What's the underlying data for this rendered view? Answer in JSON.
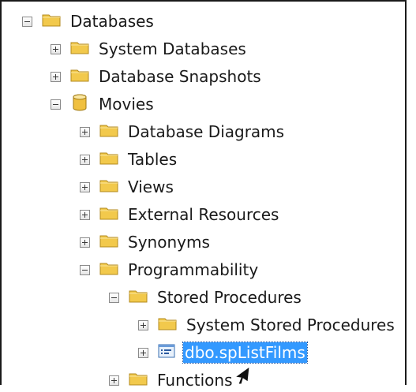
{
  "tree": {
    "items": [
      {
        "label": "Databases",
        "level": 0,
        "state": "expanded",
        "icon": "folder-icon"
      },
      {
        "label": "System Databases",
        "level": 1,
        "state": "collapsed",
        "icon": "folder-icon"
      },
      {
        "label": "Database Snapshots",
        "level": 1,
        "state": "collapsed",
        "icon": "folder-icon"
      },
      {
        "label": "Movies",
        "level": 1,
        "state": "expanded",
        "icon": "database-icon"
      },
      {
        "label": "Database Diagrams",
        "level": 2,
        "state": "collapsed",
        "icon": "folder-icon"
      },
      {
        "label": "Tables",
        "level": 2,
        "state": "collapsed",
        "icon": "folder-icon"
      },
      {
        "label": "Views",
        "level": 2,
        "state": "collapsed",
        "icon": "folder-icon"
      },
      {
        "label": "External Resources",
        "level": 2,
        "state": "collapsed",
        "icon": "folder-icon"
      },
      {
        "label": "Synonyms",
        "level": 2,
        "state": "collapsed",
        "icon": "folder-icon"
      },
      {
        "label": "Programmability",
        "level": 2,
        "state": "expanded",
        "icon": "folder-icon"
      },
      {
        "label": "Stored Procedures",
        "level": 3,
        "state": "expanded",
        "icon": "folder-icon"
      },
      {
        "label": "System Stored Procedures",
        "level": 4,
        "state": "collapsed",
        "icon": "folder-icon"
      },
      {
        "label": "dbo.spListFilms",
        "level": 4,
        "state": "collapsed",
        "icon": "stored-procedure-icon",
        "selected": true
      },
      {
        "label": "Functions",
        "level": 3,
        "state": "collapsed",
        "icon": "folder-icon"
      }
    ]
  },
  "colors": {
    "selection_bg": "#3399ff",
    "selection_text": "#ffffff",
    "folder_fill": "#f2c94c",
    "database_fill": "#f0c040"
  }
}
